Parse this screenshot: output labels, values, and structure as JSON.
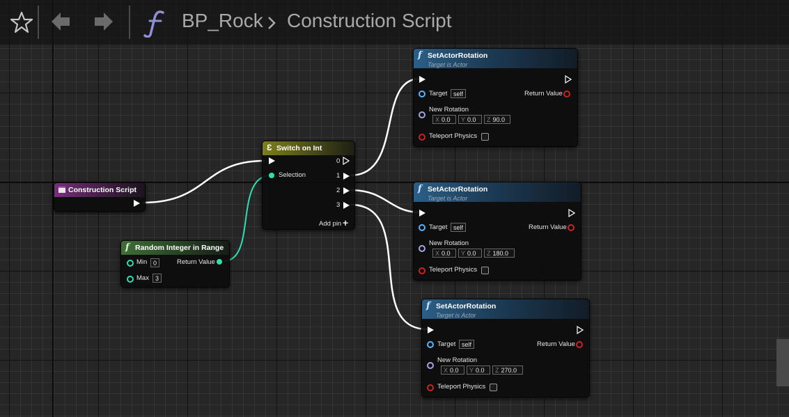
{
  "toolbar": {
    "breadcrumb": {
      "asset": "BP_Rock",
      "separator": "›",
      "graph": "Construction Script"
    },
    "icons": [
      "star-icon",
      "back-arrow-icon",
      "forward-arrow-icon",
      "function-icon"
    ]
  },
  "nodes": {
    "construction_script": {
      "title": "Construction Script"
    },
    "random_integer": {
      "title": "Random Integer in Range",
      "min_label": "Min",
      "min_value": "0",
      "max_label": "Max",
      "max_value": "3",
      "return_label": "Return Value"
    },
    "switch_on_int": {
      "title": "Switch on Int",
      "selection_label": "Selection",
      "outputs": [
        "0",
        "1",
        "2",
        "3"
      ],
      "add_pin_label": "Add pin",
      "add_pin_symbol": "+"
    },
    "set_actor_rotation": [
      {
        "title": "SetActorRotation",
        "subtitle": "Target is Actor",
        "target_label": "Target",
        "target_value": "self",
        "return_label": "Return Value",
        "new_rotation_label": "New Rotation",
        "x_label": "X",
        "x": "0.0",
        "y_label": "Y",
        "y": "0.0",
        "z_label": "Z",
        "z": "90.0",
        "teleport_label": "Teleport Physics"
      },
      {
        "title": "SetActorRotation",
        "subtitle": "Target is Actor",
        "target_label": "Target",
        "target_value": "self",
        "return_label": "Return Value",
        "new_rotation_label": "New Rotation",
        "x_label": "X",
        "x": "0.0",
        "y_label": "Y",
        "y": "0.0",
        "z_label": "Z",
        "z": "180.0",
        "teleport_label": "Teleport Physics"
      },
      {
        "title": "SetActorRotation",
        "subtitle": "Target is Actor",
        "target_label": "Target",
        "target_value": "self",
        "return_label": "Return Value",
        "new_rotation_label": "New Rotation",
        "x_label": "X",
        "x": "0.0",
        "y_label": "Y",
        "y": "0.0",
        "z_label": "Z",
        "z": "270.0",
        "teleport_label": "Teleport Physics"
      }
    ]
  },
  "colors": {
    "exec_wire": "#ffffff",
    "int_wire": "#2ee0b0",
    "function_header": "#2b5f88",
    "event_header": "#782f7c",
    "switch_header": "#7c7f1a",
    "pure_header": "#3f6e36"
  }
}
